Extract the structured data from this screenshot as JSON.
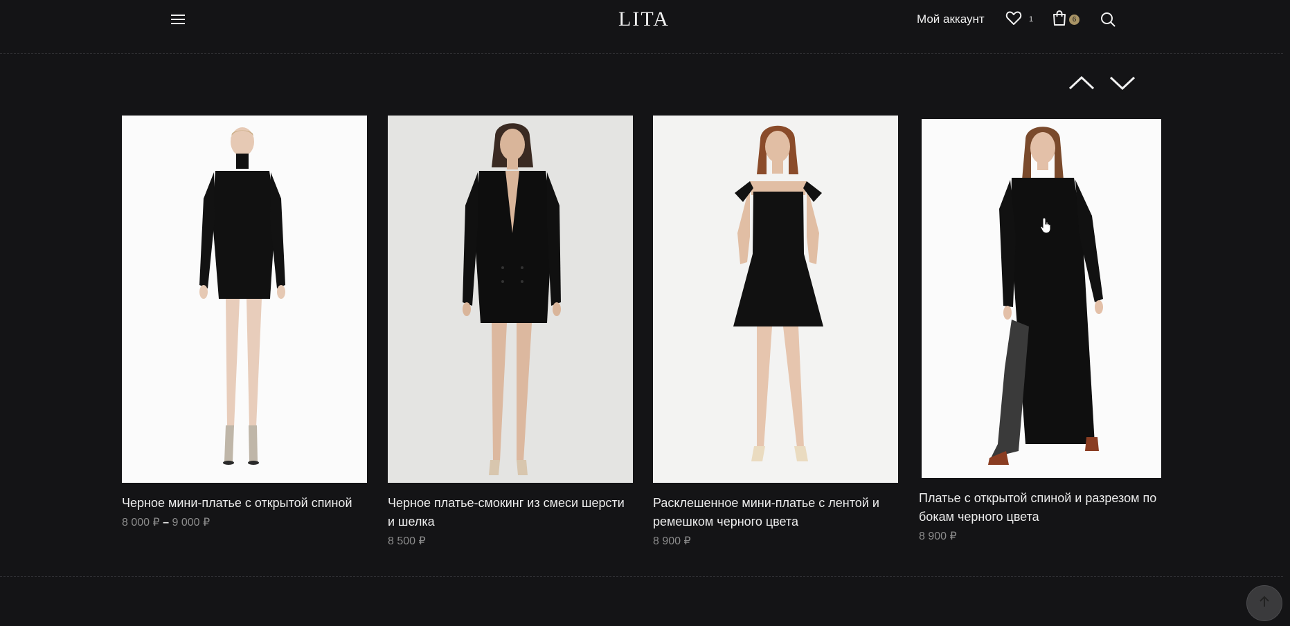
{
  "header": {
    "logo": "LITA",
    "account_label": "Мой аккаунт",
    "wishlist_count": "1",
    "cart_count": "6",
    "menu_icon": "hamburger-menu-icon",
    "search_icon": "search-icon"
  },
  "colors": {
    "background": "#141416",
    "badge": "#a99466",
    "price": "#8c8c8c"
  },
  "products": [
    {
      "name": "Черное мини-платье с открытой спиной",
      "price_from": "8 000 ₽",
      "price_sep": "–",
      "price_to": "9 000 ₽"
    },
    {
      "name": "Черное платье-смокинг из смеси шерсти и шелка",
      "price": "8 500 ₽"
    },
    {
      "name": "Расклешенное мини-платье с лентой и ремешком черного цвета",
      "price": "8 900 ₽"
    },
    {
      "name": "Платье с открытой спиной и разрезом по бокам черного цвета",
      "price": "8 900 ₽"
    }
  ]
}
